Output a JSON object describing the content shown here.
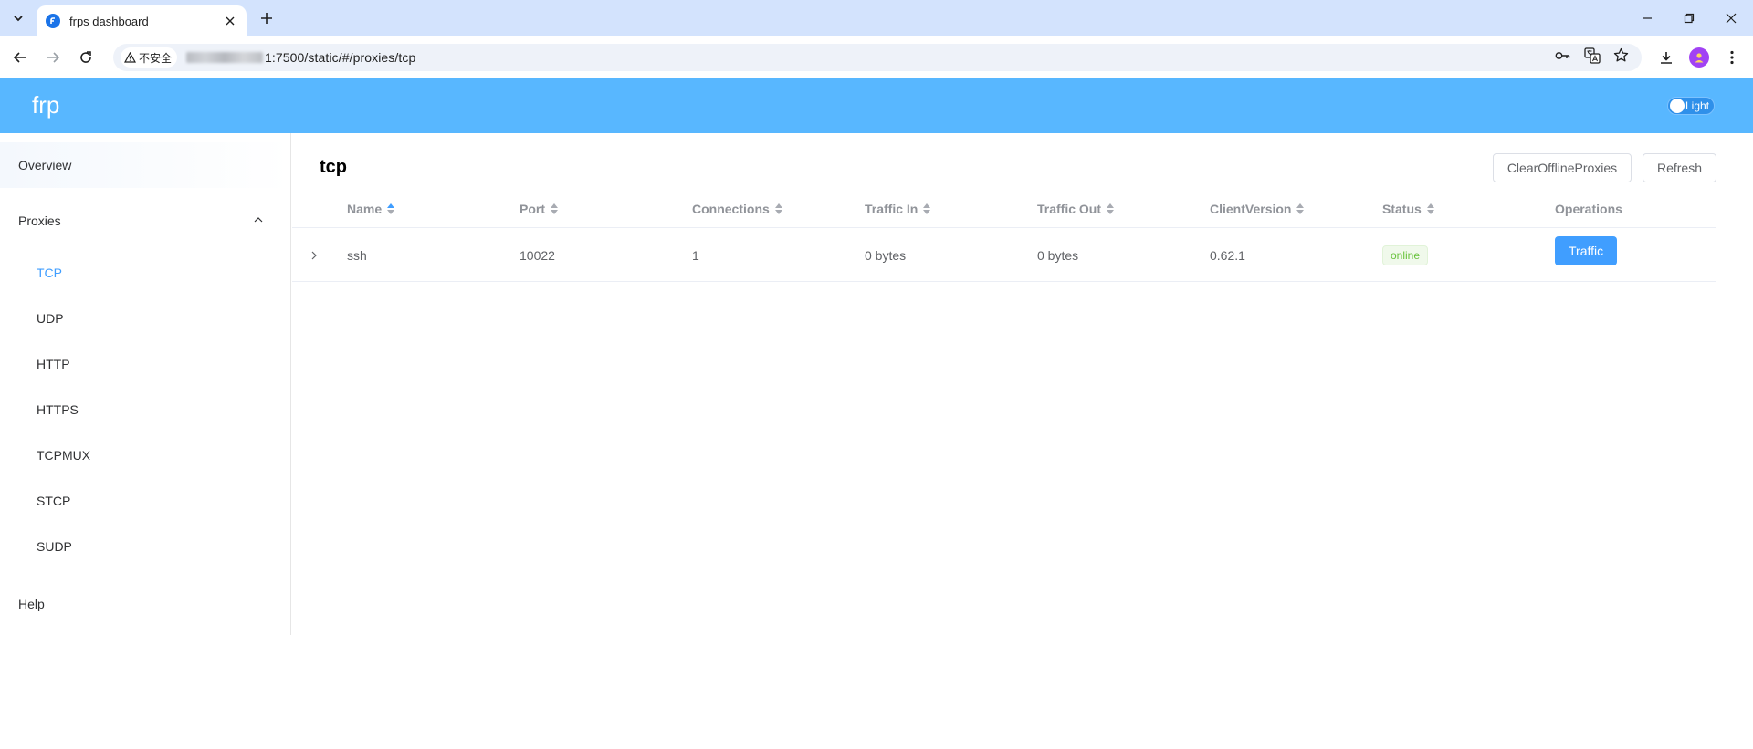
{
  "browser": {
    "tab_title": "frps dashboard",
    "security_label": "不安全",
    "url_suffix": "1:7500/static/#/proxies/tcp"
  },
  "app": {
    "logo": "frp",
    "theme_label": "Light"
  },
  "sidebar": {
    "overview": "Overview",
    "proxies": "Proxies",
    "proxy_types": [
      "TCP",
      "UDP",
      "HTTP",
      "HTTPS",
      "TCPMUX",
      "STCP",
      "SUDP"
    ],
    "active_type": "TCP",
    "help": "Help"
  },
  "main": {
    "title": "tcp",
    "clear_button": "ClearOfflineProxies",
    "refresh_button": "Refresh",
    "columns": [
      "Name",
      "Port",
      "Connections",
      "Traffic In",
      "Traffic Out",
      "ClientVersion",
      "Status",
      "Operations"
    ],
    "rows": [
      {
        "name": "ssh",
        "port": "10022",
        "connections": "1",
        "traffic_in": "0 bytes",
        "traffic_out": "0 bytes",
        "client_version": "0.62.1",
        "status": "online",
        "operation": "Traffic"
      }
    ]
  },
  "colors": {
    "header": "#58b7ff",
    "accent": "#409eff",
    "online": "#67c23a"
  }
}
